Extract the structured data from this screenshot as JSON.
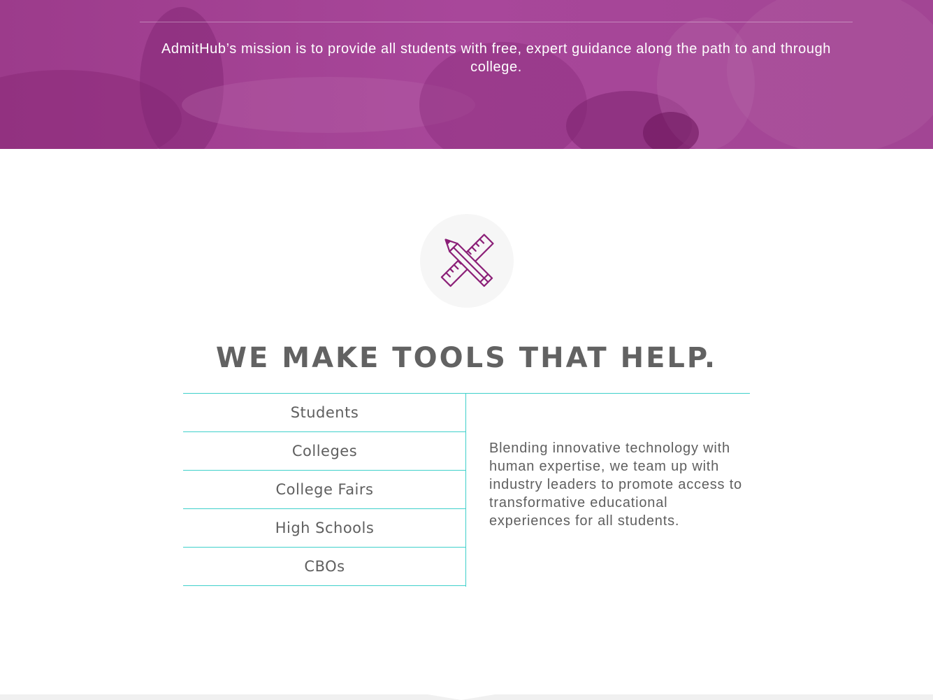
{
  "hero": {
    "mission": "AdmitHub’s mission is to provide all students with free, expert guidance along the path to and through college."
  },
  "tools_section": {
    "icon": "pencil-ruler-icon",
    "heading": "WE MAKE TOOLS THAT HELP.",
    "audiences": [
      {
        "label": "Students"
      },
      {
        "label": "Colleges"
      },
      {
        "label": "College Fairs"
      },
      {
        "label": "High Schools"
      },
      {
        "label": "CBOs"
      }
    ],
    "description": "Blending innovative technology with human expertise, we team up with industry leaders to promote access to transformative educational experiences for all students."
  },
  "colors": {
    "brand_purple": "#a0428f",
    "icon_purple": "#8b1f77",
    "accent_teal": "#3fd0cb",
    "text_gray": "#5f5f5f"
  }
}
